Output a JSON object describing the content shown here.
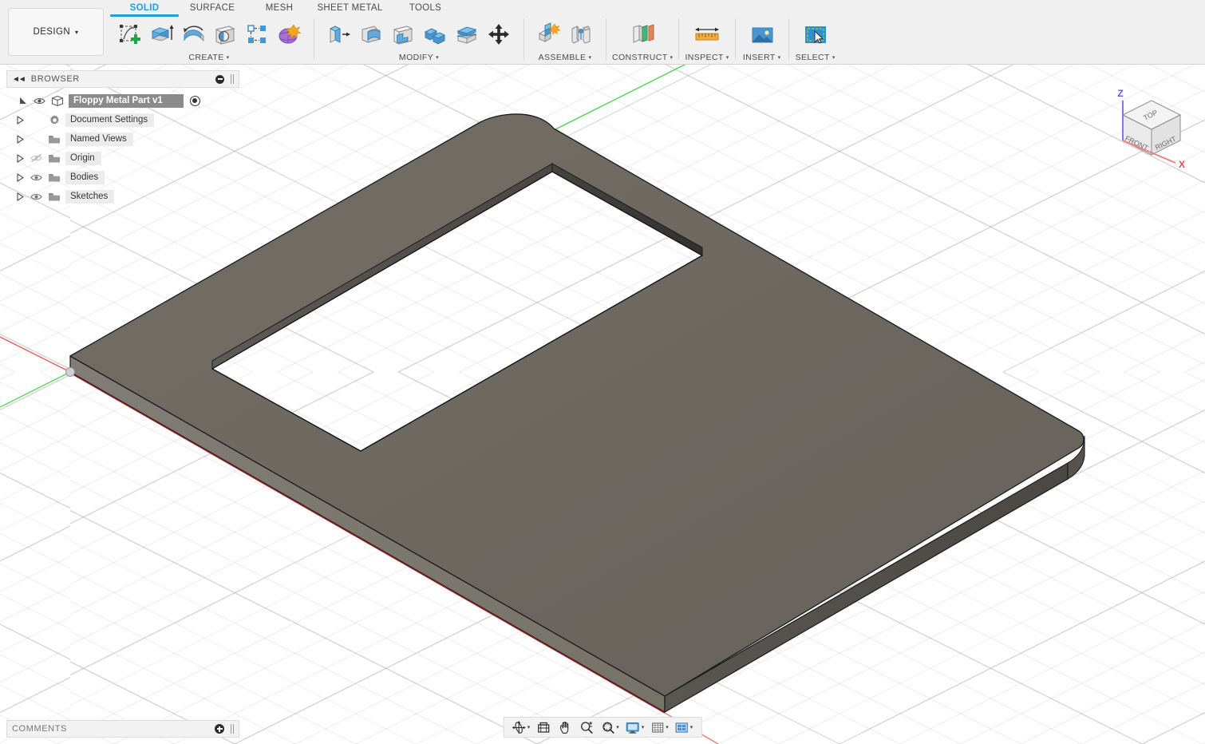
{
  "app": {
    "workspace_label": "DESIGN",
    "workspace_caret": "▾"
  },
  "tabs": [
    {
      "label": "SOLID",
      "active": true
    },
    {
      "label": "SURFACE",
      "active": false
    },
    {
      "label": "MESH",
      "active": false
    },
    {
      "label": "SHEET METAL",
      "active": false
    },
    {
      "label": "TOOLS",
      "active": false
    }
  ],
  "toolbar_groups": [
    {
      "label": "CREATE",
      "caret": "▾",
      "icons": [
        {
          "name": "create-sketch-icon"
        },
        {
          "name": "extrude-icon"
        },
        {
          "name": "revolve-icon"
        },
        {
          "name": "hole-icon"
        },
        {
          "name": "rectangular-pattern-icon"
        },
        {
          "name": "create-form-icon"
        }
      ]
    },
    {
      "label": "MODIFY",
      "caret": "▾",
      "icons": [
        {
          "name": "press-pull-icon"
        },
        {
          "name": "fillet-icon"
        },
        {
          "name": "shell-icon"
        },
        {
          "name": "combine-icon"
        },
        {
          "name": "split-face-icon"
        },
        {
          "name": "move-copy-icon"
        }
      ]
    },
    {
      "label": "ASSEMBLE",
      "caret": "▾",
      "icons": [
        {
          "name": "new-component-icon"
        },
        {
          "name": "joint-icon"
        }
      ]
    },
    {
      "label": "CONSTRUCT",
      "caret": "▾",
      "icons": [
        {
          "name": "offset-plane-icon"
        }
      ]
    },
    {
      "label": "INSPECT",
      "caret": "▾",
      "icons": [
        {
          "name": "measure-icon"
        }
      ]
    },
    {
      "label": "INSERT",
      "caret": "▾",
      "icons": [
        {
          "name": "insert-image-icon"
        }
      ]
    },
    {
      "label": "SELECT",
      "caret": "▾",
      "icons": [
        {
          "name": "select-window-icon"
        }
      ]
    }
  ],
  "browser": {
    "title": "BROWSER",
    "collapse_icon": "collapse-left-arrows-icon",
    "minimize_icon": "minus-circle-icon",
    "root": {
      "label": "Floppy Metal Part v1",
      "visible": true,
      "expanded": true,
      "activated": true
    },
    "items": [
      {
        "label": "Document Settings",
        "icon": "gear-icon",
        "has_eye": false,
        "eye_state": "none",
        "expanded": false
      },
      {
        "label": "Named Views",
        "icon": "folder-icon",
        "has_eye": false,
        "eye_state": "none",
        "expanded": false
      },
      {
        "label": "Origin",
        "icon": "folder-icon",
        "has_eye": true,
        "eye_state": "hidden",
        "expanded": false
      },
      {
        "label": "Bodies",
        "icon": "folder-icon",
        "has_eye": true,
        "eye_state": "visible",
        "expanded": false
      },
      {
        "label": "Sketches",
        "icon": "folder-icon",
        "has_eye": true,
        "eye_state": "visible",
        "expanded": false
      }
    ]
  },
  "comments": {
    "title": "COMMENTS",
    "add_icon": "plus-circle-icon"
  },
  "navbar": {
    "items": [
      {
        "name": "orbit-icon",
        "caret": "▾"
      },
      {
        "name": "look-at-icon",
        "caret": ""
      },
      {
        "name": "pan-icon",
        "caret": ""
      },
      {
        "name": "zoom-icon",
        "caret": ""
      },
      {
        "name": "fit-icon",
        "caret": "▾"
      },
      {
        "name": "display-settings-icon",
        "caret": "▾"
      },
      {
        "name": "grid-snaps-icon",
        "caret": "▾"
      },
      {
        "name": "viewports-icon",
        "caret": "▾"
      }
    ]
  },
  "viewcube": {
    "faces": {
      "top": "TOP",
      "front": "FRONT",
      "right": "RIGHT"
    },
    "axes": {
      "z": "Z",
      "x": "X"
    }
  },
  "viewport": {
    "model_name": "Floppy Metal Part",
    "colors": {
      "top_face": "#6d6960",
      "front_side_face": "#7c7a73",
      "right_side_face": "#504d47",
      "inner_cut_face": "#3d3b37",
      "inner_cut_face_2": "#5b5852",
      "edge": "#1b1b1b",
      "x_axis": "#e03a3a",
      "y_axis": "#35d135",
      "x_axis_dark": "#8c1f1f",
      "background": "#ffffff",
      "accent_blue": "#1ba1e2"
    }
  }
}
